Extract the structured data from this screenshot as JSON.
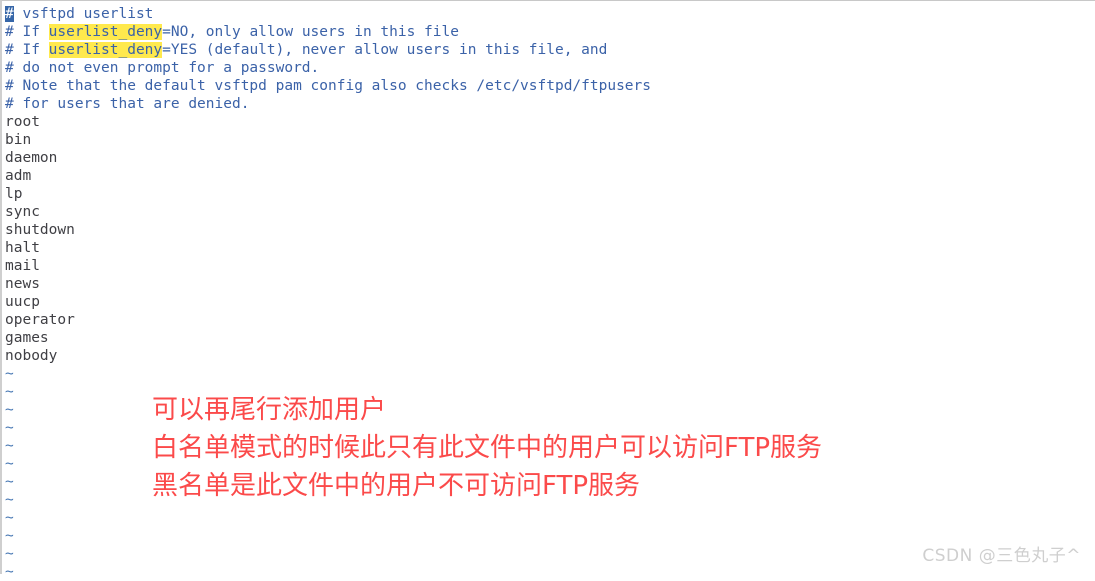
{
  "editor": {
    "app": "vim",
    "colors": {
      "background": "#ffffff",
      "comment_text": "#3b62a8",
      "entry_text": "#3f3f44",
      "tilde": "#4878b4",
      "cursor_bg": "#3666a8",
      "cursor_fg": "#ffffff",
      "search_highlight_bg": "#ffe94d",
      "annotation_red": "#fb4a4a",
      "watermark_gray": "#cfcfcf"
    },
    "cursor_char": "#",
    "comment_lines": [
      {
        "prefix": " vsftpd userlist",
        "segments": []
      },
      {
        "before": "# If ",
        "highlight": "userlist_deny",
        "after": "=NO, only allow users in this file"
      },
      {
        "before": "# If ",
        "highlight": "userlist_deny",
        "after": "=YES (default), never allow users in this file, and"
      },
      {
        "before": "# do not even prompt for a password.",
        "highlight": "",
        "after": ""
      },
      {
        "before": "# Note that the default vsftpd pam config also checks /etc/vsftpd/ftpusers",
        "highlight": "",
        "after": ""
      },
      {
        "before": "# for users that are denied.",
        "highlight": "",
        "after": ""
      }
    ],
    "line1_text": " vsftpd userlist",
    "user_entries": [
      "root",
      "bin",
      "daemon",
      "adm",
      "lp",
      "sync",
      "shutdown",
      "halt",
      "mail",
      "news",
      "uucp",
      "operator",
      "games",
      "nobody"
    ],
    "tilde_char": "~",
    "tilde_count": 12
  },
  "annotations": [
    "可以再尾行添加用户",
    "白名单模式的时候此只有此文件中的用户可以访问FTP服务",
    "黑名单是此文件中的用户不可访问FTP服务"
  ],
  "watermark": "CSDN @三色丸子^"
}
